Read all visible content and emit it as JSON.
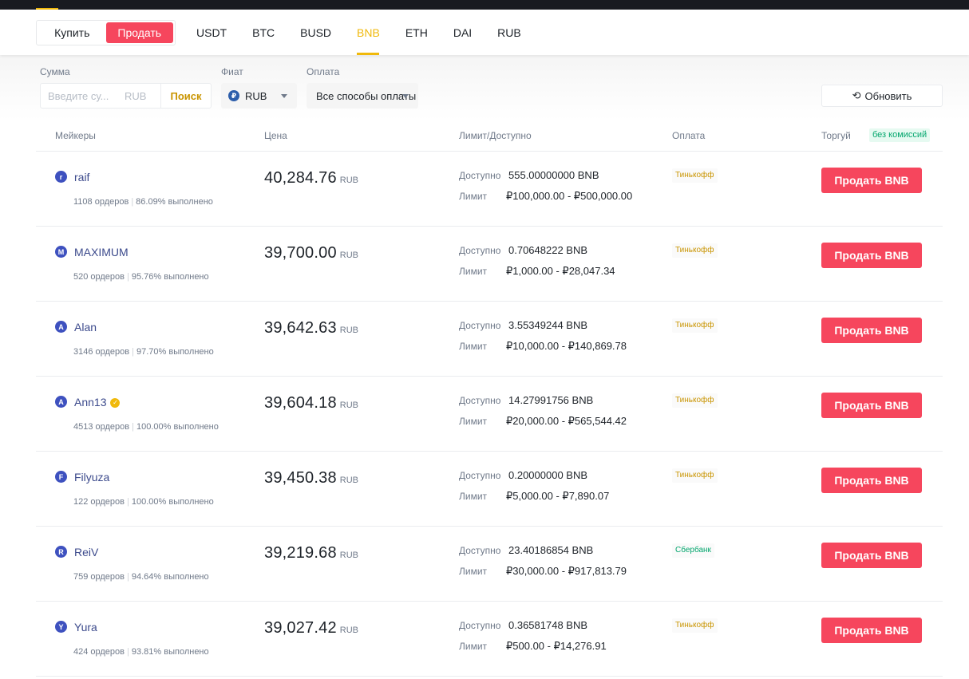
{
  "trade_toggle": {
    "buy": "Купить",
    "sell": "Продать",
    "active": "sell"
  },
  "asset_tabs": [
    "USDT",
    "BTC",
    "BUSD",
    "BNB",
    "ETH",
    "DAI",
    "RUB"
  ],
  "active_asset": "BNB",
  "filters": {
    "amount_label": "Сумма",
    "amount_placeholder": "Введите су...",
    "amount_unit": "RUB",
    "search_button": "Поиск",
    "fiat_label": "Фиат",
    "fiat_value": "RUB",
    "fiat_icon": "₽",
    "payment_label": "Оплата",
    "payment_value": "Все способы оплаты",
    "refresh_button": "Обновить"
  },
  "table": {
    "headers": {
      "makers": "Мейкеры",
      "price": "Цена",
      "limit": "Лимит/Доступно",
      "payment": "Оплата",
      "trade": "Торгуй",
      "fee_badge": "без комиссий"
    },
    "available_label": "Доступно",
    "limit_label": "Лимит",
    "rows": [
      {
        "avatar": "r",
        "name": "raif",
        "verified": false,
        "orders": "1108 ордеров",
        "completion": "86.09% выполнено",
        "price": "40,284.76",
        "currency": "RUB",
        "available": "555.00000000 BNB",
        "limit": "₽100,000.00 - ₽500,000.00",
        "payment": "Тинькофф",
        "payment_kind": "tinkoff",
        "action": "Продать BNB"
      },
      {
        "avatar": "M",
        "name": "MAXIMUM",
        "verified": false,
        "orders": "520 ордеров",
        "completion": "95.76% выполнено",
        "price": "39,700.00",
        "currency": "RUB",
        "available": "0.70648222 BNB",
        "limit": "₽1,000.00 - ₽28,047.34",
        "payment": "Тинькофф",
        "payment_kind": "tinkoff",
        "action": "Продать BNB"
      },
      {
        "avatar": "A",
        "name": "Alan",
        "verified": false,
        "orders": "3146 ордеров",
        "completion": "97.70% выполнено",
        "price": "39,642.63",
        "currency": "RUB",
        "available": "3.55349244 BNB",
        "limit": "₽10,000.00 - ₽140,869.78",
        "payment": "Тинькофф",
        "payment_kind": "tinkoff",
        "action": "Продать BNB"
      },
      {
        "avatar": "A",
        "name": "Ann13",
        "verified": true,
        "orders": "4513 ордеров",
        "completion": "100.00% выполнено",
        "price": "39,604.18",
        "currency": "RUB",
        "available": "14.27991756 BNB",
        "limit": "₽20,000.00 - ₽565,544.42",
        "payment": "Тинькофф",
        "payment_kind": "tinkoff",
        "action": "Продать BNB"
      },
      {
        "avatar": "F",
        "name": "Filyuza",
        "verified": false,
        "orders": "122 ордеров",
        "completion": "100.00% выполнено",
        "price": "39,450.38",
        "currency": "RUB",
        "available": "0.20000000 BNB",
        "limit": "₽5,000.00 - ₽7,890.07",
        "payment": "Тинькофф",
        "payment_kind": "tinkoff",
        "action": "Продать BNB"
      },
      {
        "avatar": "R",
        "name": "ReiV",
        "verified": false,
        "orders": "759 ордеров",
        "completion": "94.64% выполнено",
        "price": "39,219.68",
        "currency": "RUB",
        "available": "23.40186854 BNB",
        "limit": "₽30,000.00 - ₽917,813.79",
        "payment": "Сбербанк",
        "payment_kind": "sber",
        "action": "Продать BNB"
      },
      {
        "avatar": "Y",
        "name": "Yura",
        "verified": false,
        "orders": "424 ордеров",
        "completion": "93.81% выполнено",
        "price": "39,027.42",
        "currency": "RUB",
        "available": "0.36581748 BNB",
        "limit": "₽500.00 - ₽14,276.91",
        "payment": "Тинькофф",
        "payment_kind": "tinkoff",
        "action": "Продать BNB"
      }
    ]
  },
  "colors": {
    "accent": "#f0b90b",
    "sell": "#f6465d",
    "fee_badge": "#03a66d",
    "tinkoff": "#c99400",
    "sber": "#03a66d",
    "avatar": "#3e51bf"
  }
}
